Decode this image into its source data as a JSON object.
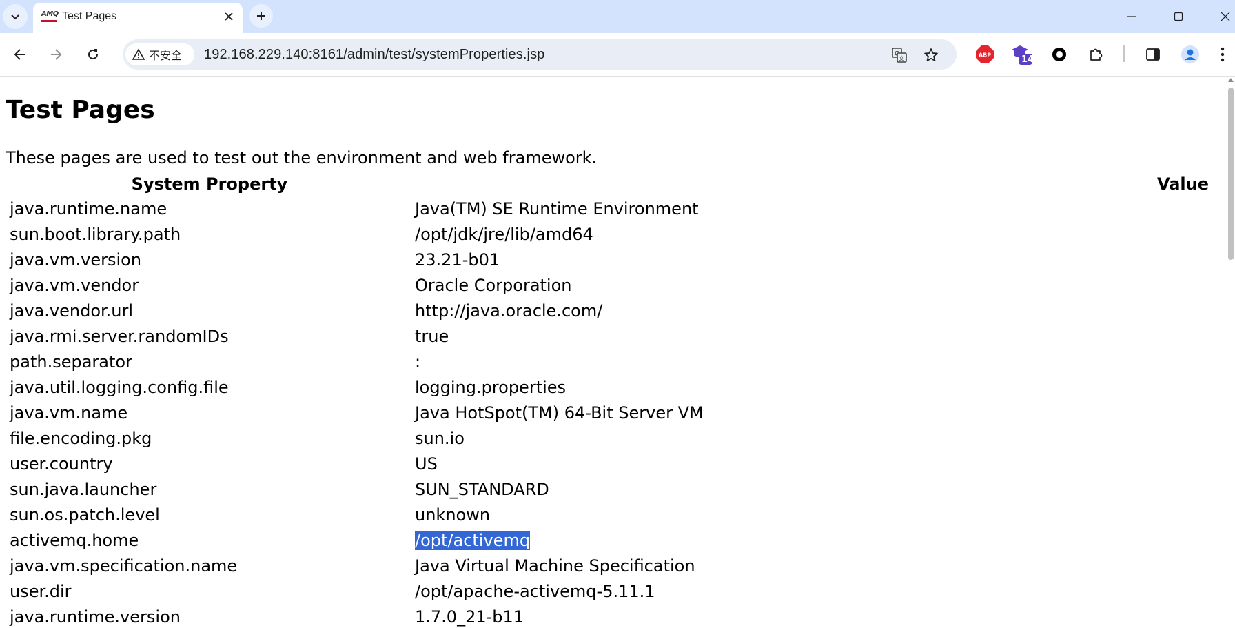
{
  "browser": {
    "tab_title": "Test Pages",
    "favicon_text": "AMQ",
    "security_label": "不安全",
    "url": "192.168.229.140:8161/admin/test/systemProperties.jsp",
    "extension_badge": "14",
    "abp_label": "ABP"
  },
  "page": {
    "heading": "Test Pages",
    "intro": "These pages are used to test out the environment and web framework.",
    "columns": {
      "property": "System Property",
      "value": "Value"
    },
    "rows": [
      {
        "key": "java.runtime.name",
        "value": "Java(TM) SE Runtime Environment"
      },
      {
        "key": "sun.boot.library.path",
        "value": "/opt/jdk/jre/lib/amd64"
      },
      {
        "key": "java.vm.version",
        "value": "23.21-b01"
      },
      {
        "key": "java.vm.vendor",
        "value": "Oracle Corporation"
      },
      {
        "key": "java.vendor.url",
        "value": "http://java.oracle.com/"
      },
      {
        "key": "java.rmi.server.randomIDs",
        "value": "true"
      },
      {
        "key": "path.separator",
        "value": ":"
      },
      {
        "key": "java.util.logging.config.file",
        "value": "logging.properties"
      },
      {
        "key": "java.vm.name",
        "value": "Java HotSpot(TM) 64-Bit Server VM"
      },
      {
        "key": "file.encoding.pkg",
        "value": "sun.io"
      },
      {
        "key": "user.country",
        "value": "US"
      },
      {
        "key": "sun.java.launcher",
        "value": "SUN_STANDARD"
      },
      {
        "key": "sun.os.patch.level",
        "value": "unknown"
      },
      {
        "key": "activemq.home",
        "value": "/opt/activemq",
        "selected": true
      },
      {
        "key": "java.vm.specification.name",
        "value": "Java Virtual Machine Specification"
      },
      {
        "key": "user.dir",
        "value": "/opt/apache-activemq-5.11.1"
      },
      {
        "key": "java.runtime.version",
        "value": "1.7.0_21-b11"
      }
    ]
  },
  "colors": {
    "tabstrip_bg": "#d3e3fd",
    "omnibox_bg": "#e9eef6",
    "selection_bg": "#3367d6",
    "abp_red": "#e4252f",
    "ext_purple": "#5b3fc4"
  }
}
